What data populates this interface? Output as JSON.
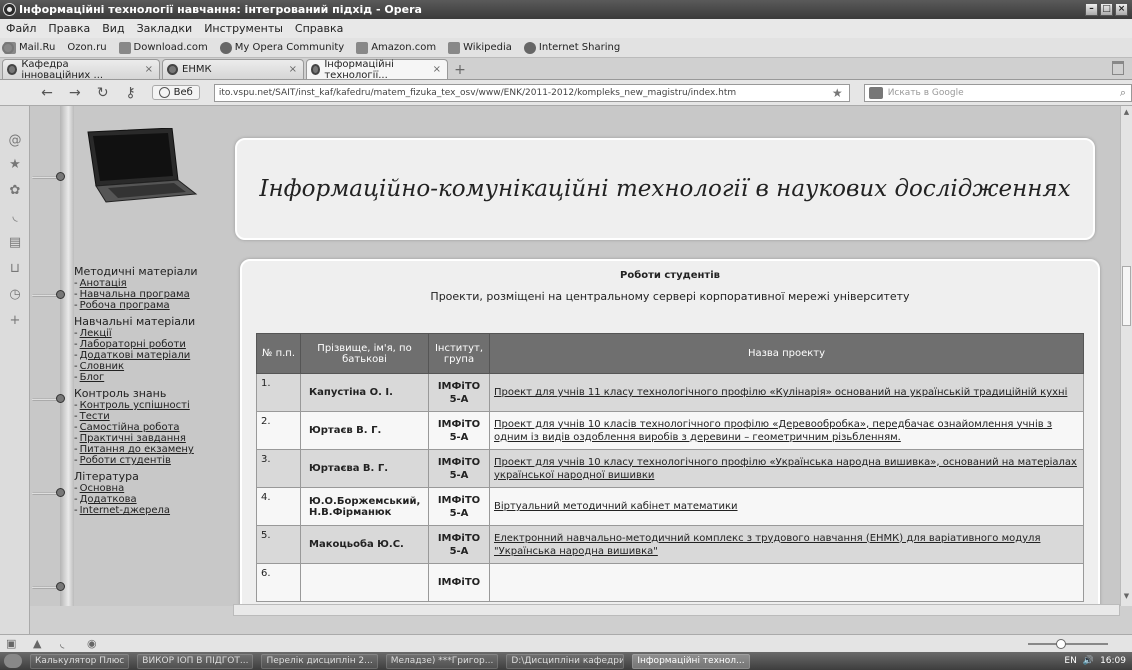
{
  "window": {
    "title": "Інформаційні технології навчання: інтегрований підхід - Opera"
  },
  "menu": [
    "Файл",
    "Правка",
    "Вид",
    "Закладки",
    "Инструменты",
    "Справка"
  ],
  "bookmarks": [
    "Mail.Ru",
    "Ozon.ru",
    "Download.com",
    "My Opera Community",
    "Amazon.com",
    "Wikipedia",
    "Internet Sharing"
  ],
  "tabs": [
    {
      "label": "Кафедра інноваційних ...",
      "close": "×"
    },
    {
      "label": "ЕНМК",
      "close": "×"
    },
    {
      "label": "Інформаційні технології...",
      "close": "×"
    }
  ],
  "nav": {
    "web_label": "Веб",
    "url": "ito.vspu.net/SAIT/inst_kaf/kafedru/matem_fizuka_tex_osv/www/ENK/2011-2012/kompleks_new_magistru/index.htm",
    "search_placeholder": "Искать в Google"
  },
  "page": {
    "header_title": "Інформаційно-комунікаційні технології в наукових дослідженнях",
    "section_title": "Роботи студентів",
    "section_subtitle": "Проекти, розміщені на центральному сервері корпоративної мережі університету"
  },
  "leftmenu": {
    "groups": [
      {
        "title": "Методичні матеріали",
        "links": [
          "Анотація",
          "Навчальна програма",
          "Робоча програма"
        ]
      },
      {
        "title": "Навчальні матеріали",
        "links": [
          "Лекції",
          "Лабораторні роботи",
          "Додаткові матеріали",
          "Словник",
          "Блог"
        ]
      },
      {
        "title": "Контроль знань",
        "links": [
          "Контроль успішності",
          "Тести",
          "Самостійна робота",
          "Практичні завдання",
          "Питання до екзамену",
          "Роботи студентів"
        ]
      },
      {
        "title": "Література",
        "links": [
          "Основна",
          "Додаткова",
          "Internet-джерела"
        ]
      }
    ]
  },
  "table": {
    "headers": [
      "№ п.п.",
      "Прізвище, ім'я, по батькові",
      "Інститут, група",
      "Назва проекту"
    ],
    "rows": [
      {
        "num": "1.",
        "name": "Капустіна О. І.",
        "inst": "ІМФіТО",
        "group": "5-А",
        "title": "Проект для учнів 11 класу технологічного профілю «Кулінарія» оснований на українській традиційній кухні"
      },
      {
        "num": "2.",
        "name": "Юртаєв В. Г.",
        "inst": "ІМФіТО",
        "group": "5-А",
        "title": "Проект для учнів 10 класів технологічного профілю «Деревообробка», передбачає ознайомлення учнів з одним із видів оздоблення виробів з деревини – геометричним різьбленням."
      },
      {
        "num": "3.",
        "name": "Юртаєва В. Г.",
        "inst": "ІМФіТО",
        "group": "5-А",
        "title": "Проект для учнів 10 класу технологічного профілю «Українська народна вишивка», оснований на матеріалах української народної вишивки"
      },
      {
        "num": "4.",
        "name": "Ю.О.Боржемський, Н.В.Фірманюк",
        "inst": "ІМФіТО",
        "group": "5-А",
        "title": "Віртуальний методичний кабінет математики"
      },
      {
        "num": "5.",
        "name": "Макоцьоба Ю.С.",
        "inst": "ІМФіТО",
        "group": "5-А",
        "title": "Електронний навчально-методичний комплекс з трудового навчання (ЕНМК) для варіативного модуля \"Українська народна вишивка\""
      },
      {
        "num": "6.",
        "name": "",
        "inst": "ІМФіТО",
        "group": "",
        "title": ""
      }
    ]
  },
  "taskbar": {
    "items": [
      "Калькулятор Плюс",
      "ВИКОР ІОП В ПІДГОТ...",
      "Перелік дисциплін 2...",
      "Меладзе) ***Григор...",
      "D:\\Дисципліни кафедри",
      "Інформаційні технол..."
    ],
    "lang": "EN",
    "clock": "16:09"
  }
}
